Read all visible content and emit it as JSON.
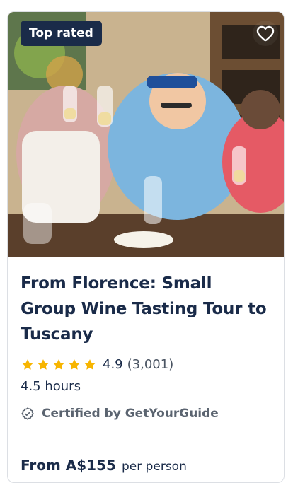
{
  "card": {
    "badge": "Top rated",
    "title": "From Florence: Small Group Wine Tasting Tour to Tuscany",
    "rating": {
      "stars": 5,
      "value": "4.9",
      "count": "(3,001)"
    },
    "duration": "4.5 hours",
    "certified": "Certified by GetYourGuide",
    "price": {
      "amount": "From A$155",
      "per": "per person"
    },
    "colors": {
      "navy": "#1a2b49",
      "star": "#f7b500",
      "muted": "#5b6470"
    },
    "icons": {
      "wishlist": "heart-icon",
      "certified": "badge-check-icon",
      "rating": "star-icon"
    }
  }
}
